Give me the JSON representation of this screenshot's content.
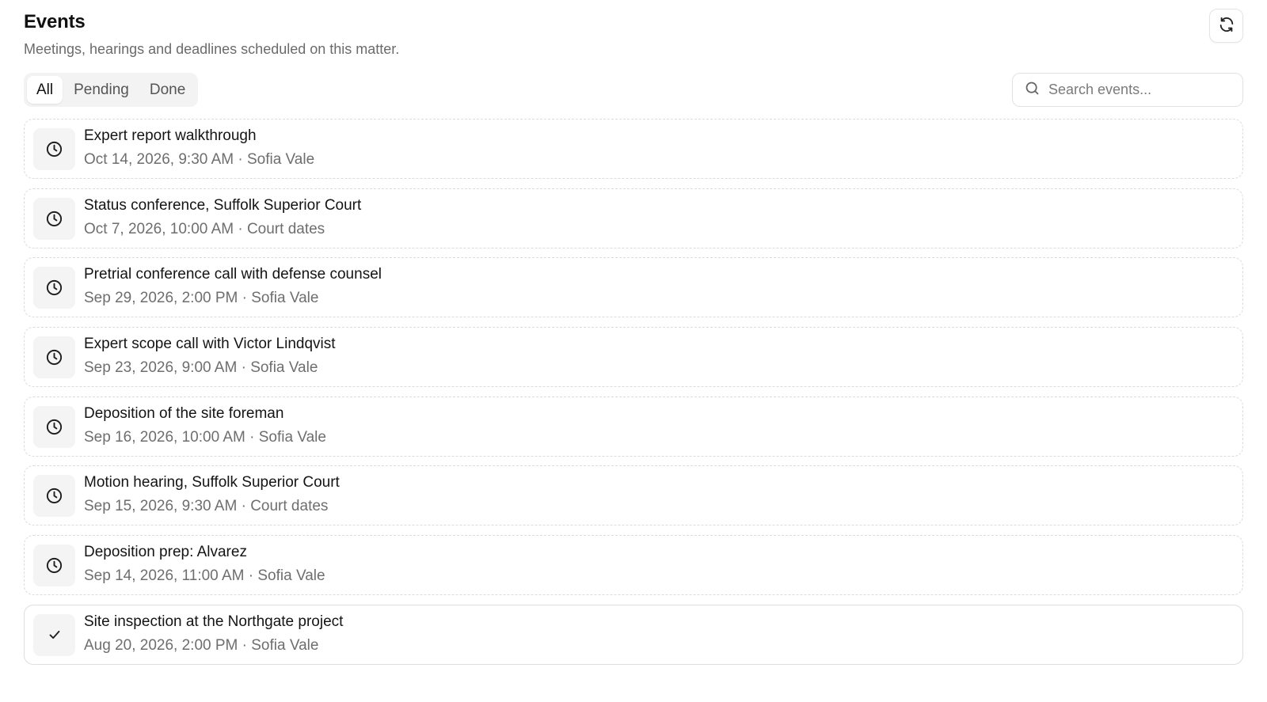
{
  "header": {
    "title": "Events",
    "subtitle": "Meetings, hearings and deadlines scheduled on this matter.",
    "refresh_icon": "refresh-icon"
  },
  "filters": {
    "tabs": [
      {
        "label": "All",
        "active": true
      },
      {
        "label": "Pending",
        "active": false
      },
      {
        "label": "Done",
        "active": false
      }
    ]
  },
  "search": {
    "placeholder": "Search events...",
    "value": "",
    "icon": "search-icon"
  },
  "events": [
    {
      "title": "Expert report walkthrough",
      "meta": "Oct 14, 2026, 9:30 AM · Sofia Vale",
      "status": "pending",
      "icon": "clock-icon"
    },
    {
      "title": "Status conference, Suffolk Superior Court",
      "meta": "Oct 7, 2026, 10:00 AM · Court dates",
      "status": "pending",
      "icon": "clock-icon"
    },
    {
      "title": "Pretrial conference call with defense counsel",
      "meta": "Sep 29, 2026, 2:00 PM · Sofia Vale",
      "status": "pending",
      "icon": "clock-icon"
    },
    {
      "title": "Expert scope call with Victor Lindqvist",
      "meta": "Sep 23, 2026, 9:00 AM · Sofia Vale",
      "status": "pending",
      "icon": "clock-icon"
    },
    {
      "title": "Deposition of the site foreman",
      "meta": "Sep 16, 2026, 10:00 AM · Sofia Vale",
      "status": "pending",
      "icon": "clock-icon"
    },
    {
      "title": "Motion hearing, Suffolk Superior Court",
      "meta": "Sep 15, 2026, 9:30 AM · Court dates",
      "status": "pending",
      "icon": "clock-icon"
    },
    {
      "title": "Deposition prep: Alvarez",
      "meta": "Sep 14, 2026, 11:00 AM · Sofia Vale",
      "status": "pending",
      "icon": "clock-icon"
    },
    {
      "title": "Site inspection at the Northgate project",
      "meta": "Aug 20, 2026, 2:00 PM · Sofia Vale",
      "status": "done",
      "icon": "check-icon"
    }
  ]
}
